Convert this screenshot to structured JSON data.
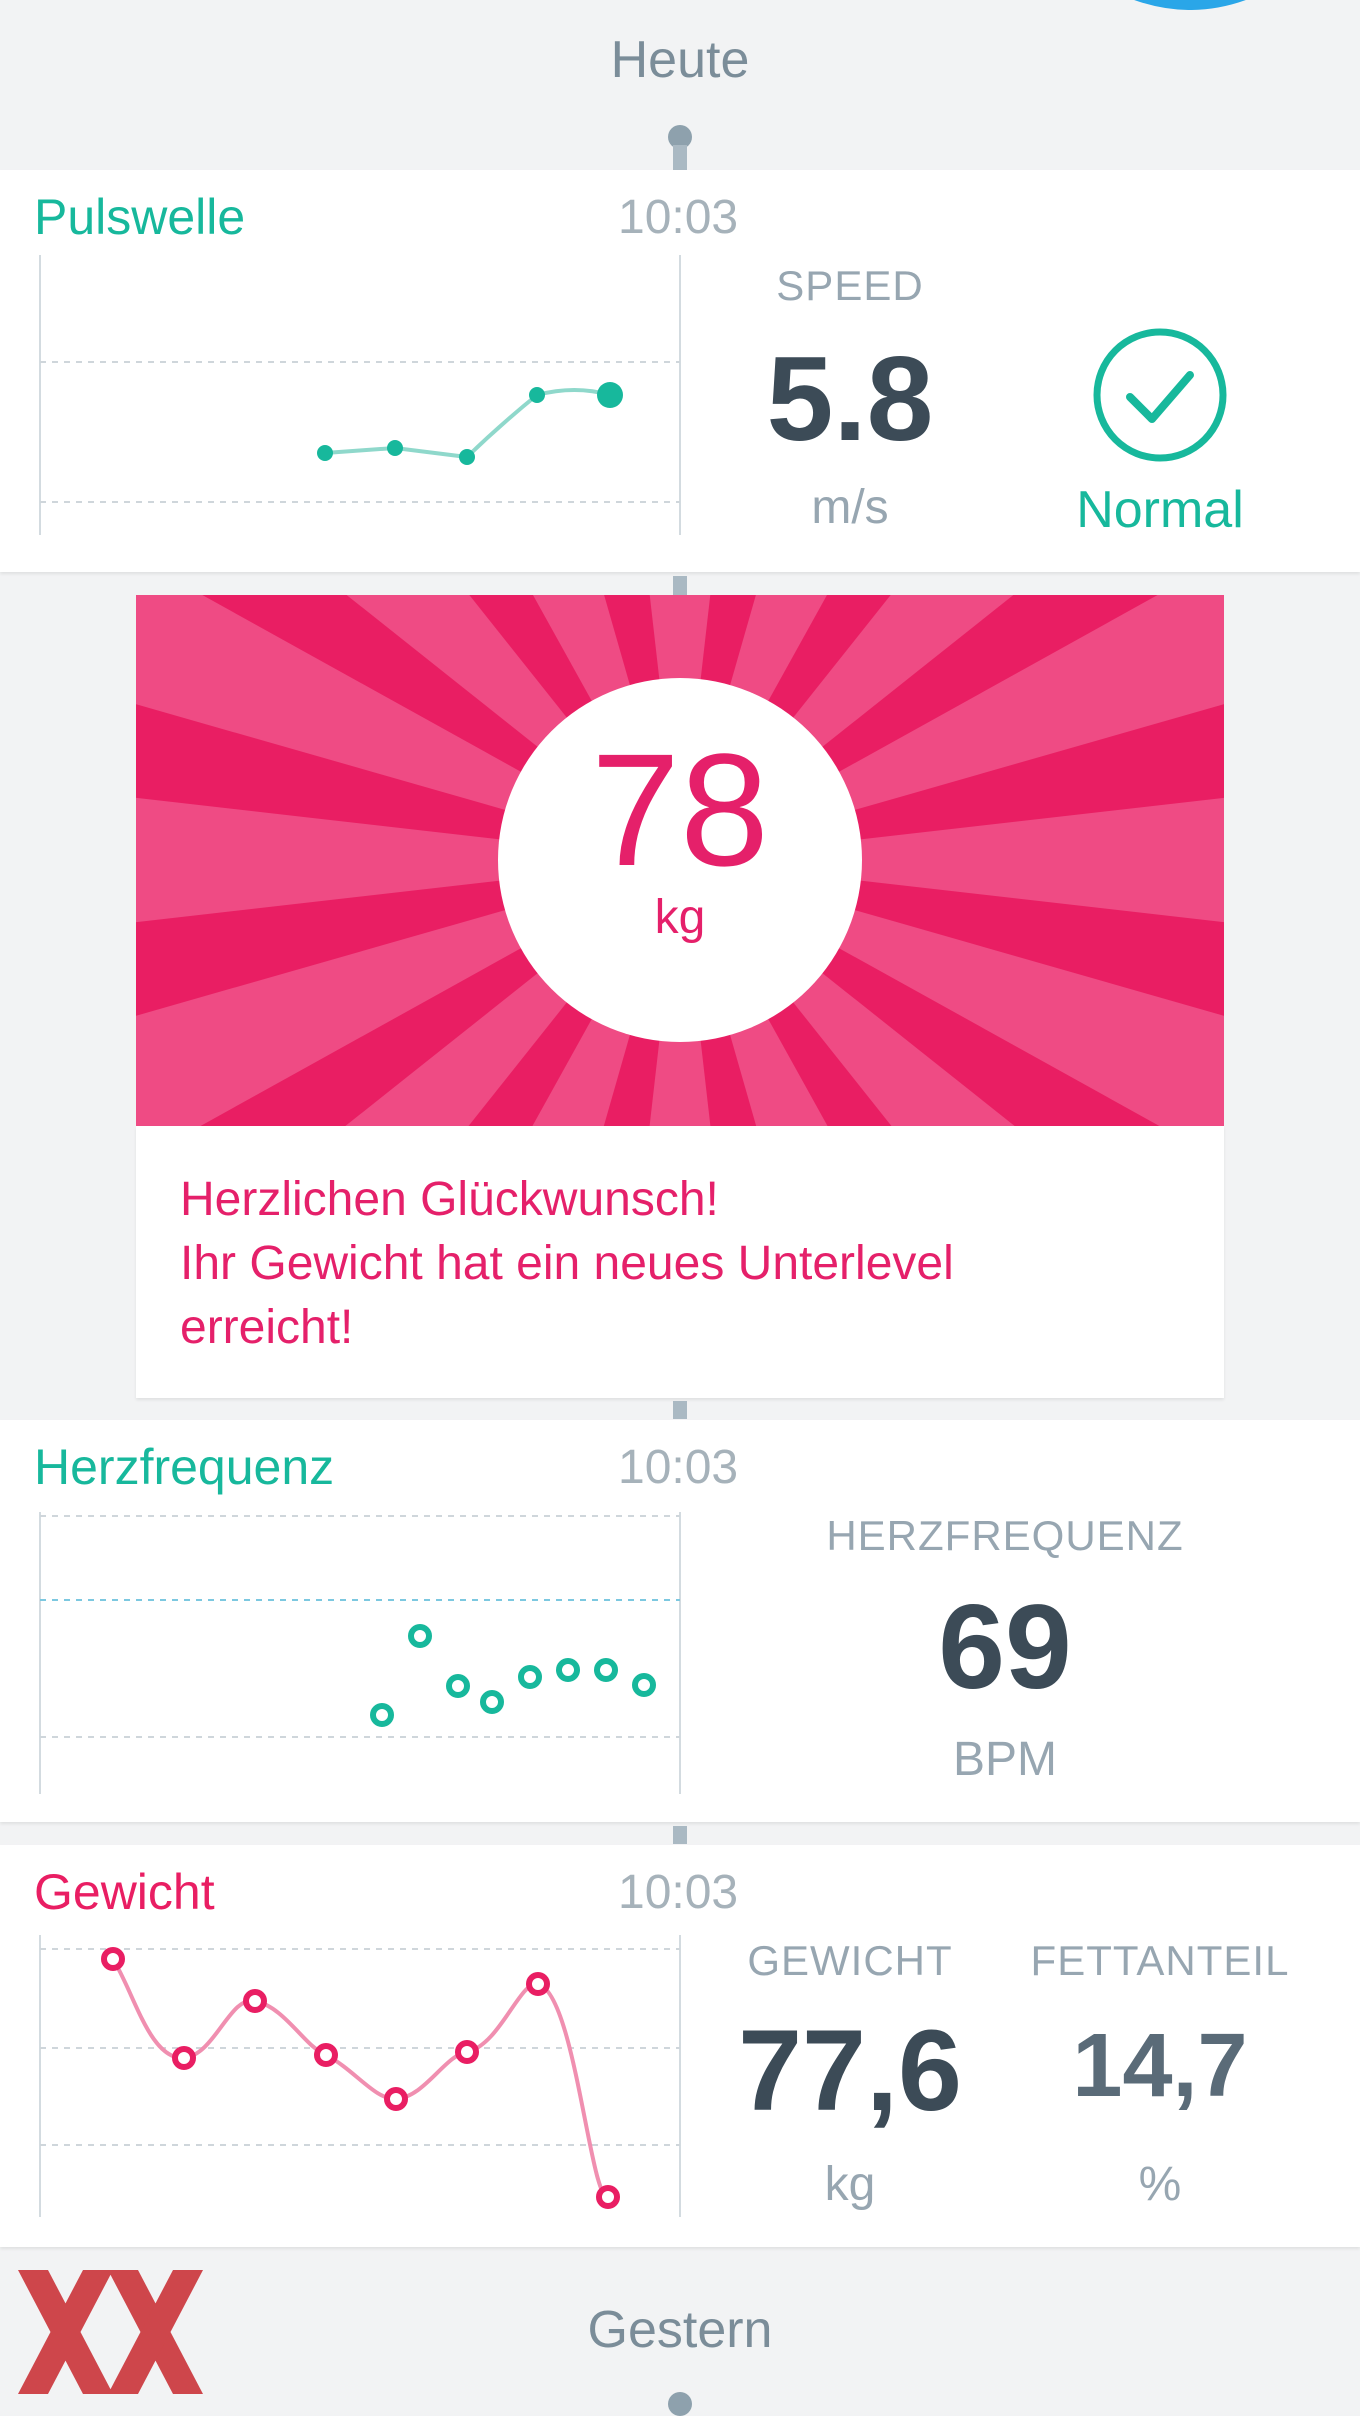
{
  "timeline": {
    "today_label": "Heute",
    "yesterday_label": "Gestern"
  },
  "colors": {
    "teal": "#17b89c",
    "pink": "#e91e63",
    "pink_text": "#e5206a",
    "gray_text": "#97a6b1",
    "dark_value": "#3c4b57",
    "light_blue": "#7cc8e0"
  },
  "pulse_wave": {
    "title": "Pulswelle",
    "time": "10:03",
    "speed_label": "SPEED",
    "speed_value": "5.8",
    "speed_unit": "m/s",
    "status_label": "Normal",
    "status_icon": "check-circle-icon"
  },
  "weight_banner": {
    "value": "78",
    "unit": "kg",
    "message_line1": "Herzlichen Glückwunsch!",
    "message_line2": "Ihr Gewicht hat ein neues Unterlevel",
    "message_line3": "erreicht!"
  },
  "heart_rate": {
    "title": "Herzfrequenz",
    "time": "10:03",
    "label": "HERZFREQUENZ",
    "value": "69",
    "unit": "BPM"
  },
  "weight": {
    "title": "Gewicht",
    "time": "10:03",
    "weight_label": "GEWICHT",
    "weight_value": "77,6",
    "weight_unit": "kg",
    "fat_label": "FETTANTEIL",
    "fat_value": "14,7",
    "fat_unit": "%"
  }
}
